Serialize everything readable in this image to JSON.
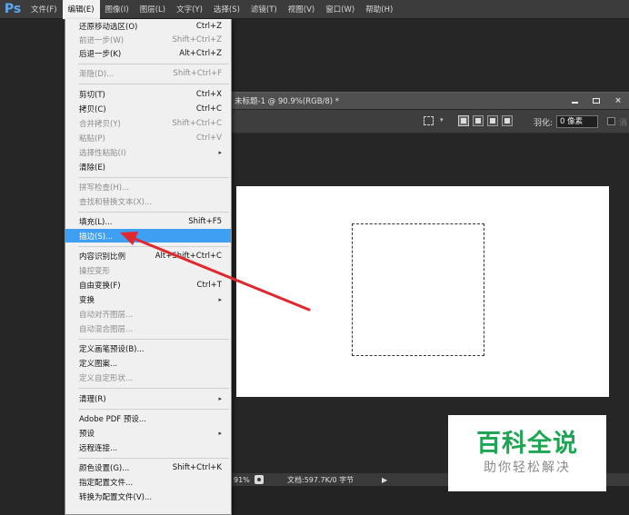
{
  "app": {
    "logo": "Ps"
  },
  "menubar": {
    "items": [
      {
        "label": "文件(F)"
      },
      {
        "label": "编辑(E)"
      },
      {
        "label": "图像(I)"
      },
      {
        "label": "图层(L)"
      },
      {
        "label": "文字(Y)"
      },
      {
        "label": "选择(S)"
      },
      {
        "label": "滤镜(T)"
      },
      {
        "label": "视图(V)"
      },
      {
        "label": "窗口(W)"
      },
      {
        "label": "帮助(H)"
      }
    ],
    "active_index": 1
  },
  "document": {
    "title": "未标题-1 @ 90.9%(RGB/8) *",
    "window_controls": {
      "minimize": "minimize-icon",
      "restore": "restore-icon",
      "close": "×"
    }
  },
  "options_bar": {
    "feather_label": "羽化:",
    "feather_value": "0 像素",
    "antialias_label": "消"
  },
  "status_bar": {
    "zoom": "91%",
    "doc_info": "文档:597.7K/0 字节",
    "arrow": "▶"
  },
  "edit_menu": {
    "items": [
      {
        "label": "还原移动选区(O)",
        "shortcut": "Ctrl+Z",
        "disabled": false
      },
      {
        "label": "前进一步(W)",
        "shortcut": "Shift+Ctrl+Z",
        "disabled": true
      },
      {
        "label": "后退一步(K)",
        "shortcut": "Alt+Ctrl+Z",
        "disabled": false
      },
      {
        "label": "渐隐(D)...",
        "shortcut": "Shift+Ctrl+F",
        "disabled": true
      },
      {
        "label": "剪切(T)",
        "shortcut": "Ctrl+X",
        "disabled": false
      },
      {
        "label": "拷贝(C)",
        "shortcut": "Ctrl+C",
        "disabled": false
      },
      {
        "label": "合并拷贝(Y)",
        "shortcut": "Shift+Ctrl+C",
        "disabled": true
      },
      {
        "label": "粘贴(P)",
        "shortcut": "Ctrl+V",
        "disabled": true
      },
      {
        "label": "选择性粘贴(I)",
        "shortcut": "",
        "disabled": true,
        "submenu": true
      },
      {
        "label": "清除(E)",
        "shortcut": "",
        "disabled": false
      },
      {
        "label": "拼写检查(H)...",
        "shortcut": "",
        "disabled": true
      },
      {
        "label": "查找和替换文本(X)...",
        "shortcut": "",
        "disabled": true
      },
      {
        "label": "填充(L)...",
        "shortcut": "Shift+F5",
        "disabled": false
      },
      {
        "label": "描边(S)...",
        "shortcut": "",
        "disabled": false,
        "highlighted": true
      },
      {
        "label": "内容识别比例",
        "shortcut": "Alt+Shift+Ctrl+C",
        "disabled": false
      },
      {
        "label": "操控变形",
        "shortcut": "",
        "disabled": true
      },
      {
        "label": "自由变换(F)",
        "shortcut": "Ctrl+T",
        "disabled": false
      },
      {
        "label": "变换",
        "shortcut": "",
        "disabled": false,
        "submenu": true
      },
      {
        "label": "自动对齐图层...",
        "shortcut": "",
        "disabled": true
      },
      {
        "label": "自动混合图层...",
        "shortcut": "",
        "disabled": true
      },
      {
        "label": "定义画笔预设(B)...",
        "shortcut": "",
        "disabled": false
      },
      {
        "label": "定义图案...",
        "shortcut": "",
        "disabled": false
      },
      {
        "label": "定义自定形状...",
        "shortcut": "",
        "disabled": true
      },
      {
        "label": "清理(R)",
        "shortcut": "",
        "disabled": false,
        "submenu": true
      },
      {
        "label": "Adobe PDF 预设...",
        "shortcut": "",
        "disabled": false
      },
      {
        "label": "预设",
        "shortcut": "",
        "disabled": false,
        "submenu": true
      },
      {
        "label": "远程连接...",
        "shortcut": "",
        "disabled": false
      },
      {
        "label": "颜色设置(G)...",
        "shortcut": "Shift+Ctrl+K",
        "disabled": false
      },
      {
        "label": "指定配置文件...",
        "shortcut": "",
        "disabled": false
      },
      {
        "label": "转换为配置文件(V)...",
        "shortcut": "",
        "disabled": false
      }
    ],
    "submenu_arrow": "▸"
  },
  "watermark": {
    "title": "百科全说",
    "subtitle": "助你轻松解决"
  },
  "colors": {
    "menu_highlight": "#3f9ff2",
    "annotation_arrow": "#e0282e",
    "watermark_green": "#1fa553",
    "ps_blue": "#5aa9f5"
  }
}
